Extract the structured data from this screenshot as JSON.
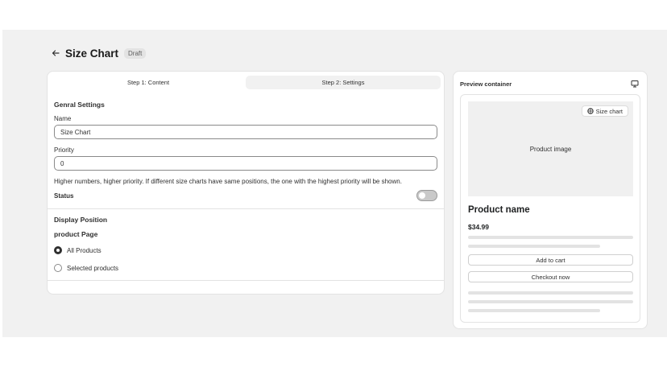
{
  "header": {
    "title": "Size Chart",
    "badge": "Draft"
  },
  "tabs": [
    {
      "label": "Step 1: Content",
      "active": true
    },
    {
      "label": "Step 2: Settings",
      "active": false
    }
  ],
  "general": {
    "heading": "Genral Settings",
    "name_label": "Name",
    "name_value": "Size Chart",
    "priority_label": "Priority",
    "priority_value": "0",
    "help_text": "Higher numbers, higher priority. If different size charts have same positions, the one with the highest priority will be shown.",
    "status_label": "Status",
    "status_on": false
  },
  "display": {
    "heading": "Display Position",
    "subheading": "product Page",
    "options": [
      {
        "label": "All Products",
        "selected": true
      },
      {
        "label": "Selected products",
        "selected": false
      }
    ]
  },
  "preview": {
    "title": "Preview container",
    "size_chart_button": "Size chart",
    "image_label": "Product image",
    "product_name": "Product name",
    "price": "$34.99",
    "add_to_cart": "Add to cart",
    "checkout": "Checkout now"
  },
  "icons": {
    "back": "arrow-left-icon",
    "device": "desktop-icon",
    "ruler": "size-chart-icon"
  }
}
